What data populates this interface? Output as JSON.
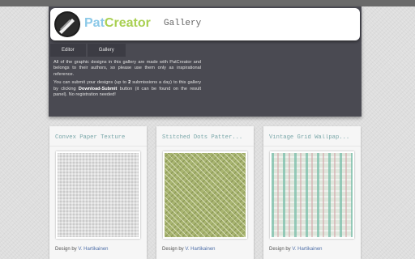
{
  "header": {
    "brand_part1": "Pat",
    "brand_part2": "Creator",
    "subtitle": "Gallery",
    "logo_icon": "pattern-logo-icon"
  },
  "nav": {
    "tabs": [
      {
        "label": "Editor"
      },
      {
        "label": "Gallery"
      }
    ]
  },
  "intro": {
    "p1": "All of the graphic designs in this gallery are made with PatCreator and belongs to their authors, so please use them only as inspirational reference.",
    "p2_before": "You can submit your designs (up to ",
    "p2_count": "2",
    "p2_mid": " submissions a day) to this gallery by clicking ",
    "p2_button": "Download-Submit",
    "p2_after": " button (it can be found on the result panel). No registration needed!"
  },
  "cards": [
    {
      "title": "Convex Paper Texture",
      "credit_prefix": "Design by",
      "author": "V. Hartikainen"
    },
    {
      "title": "Stitched Dots Patter...",
      "credit_prefix": "Design by",
      "author": "V. Hartikainen"
    },
    {
      "title": "Vintage Grid Wallpap...",
      "credit_prefix": "Design by",
      "author": "V. Hartikainen"
    }
  ],
  "colors": {
    "brand_pat": "#8cc9e8",
    "brand_creator": "#a9d052",
    "panel_bg": "#4a4a52",
    "title_color": "#7aa7a9",
    "author_link": "#4f6fa8"
  }
}
